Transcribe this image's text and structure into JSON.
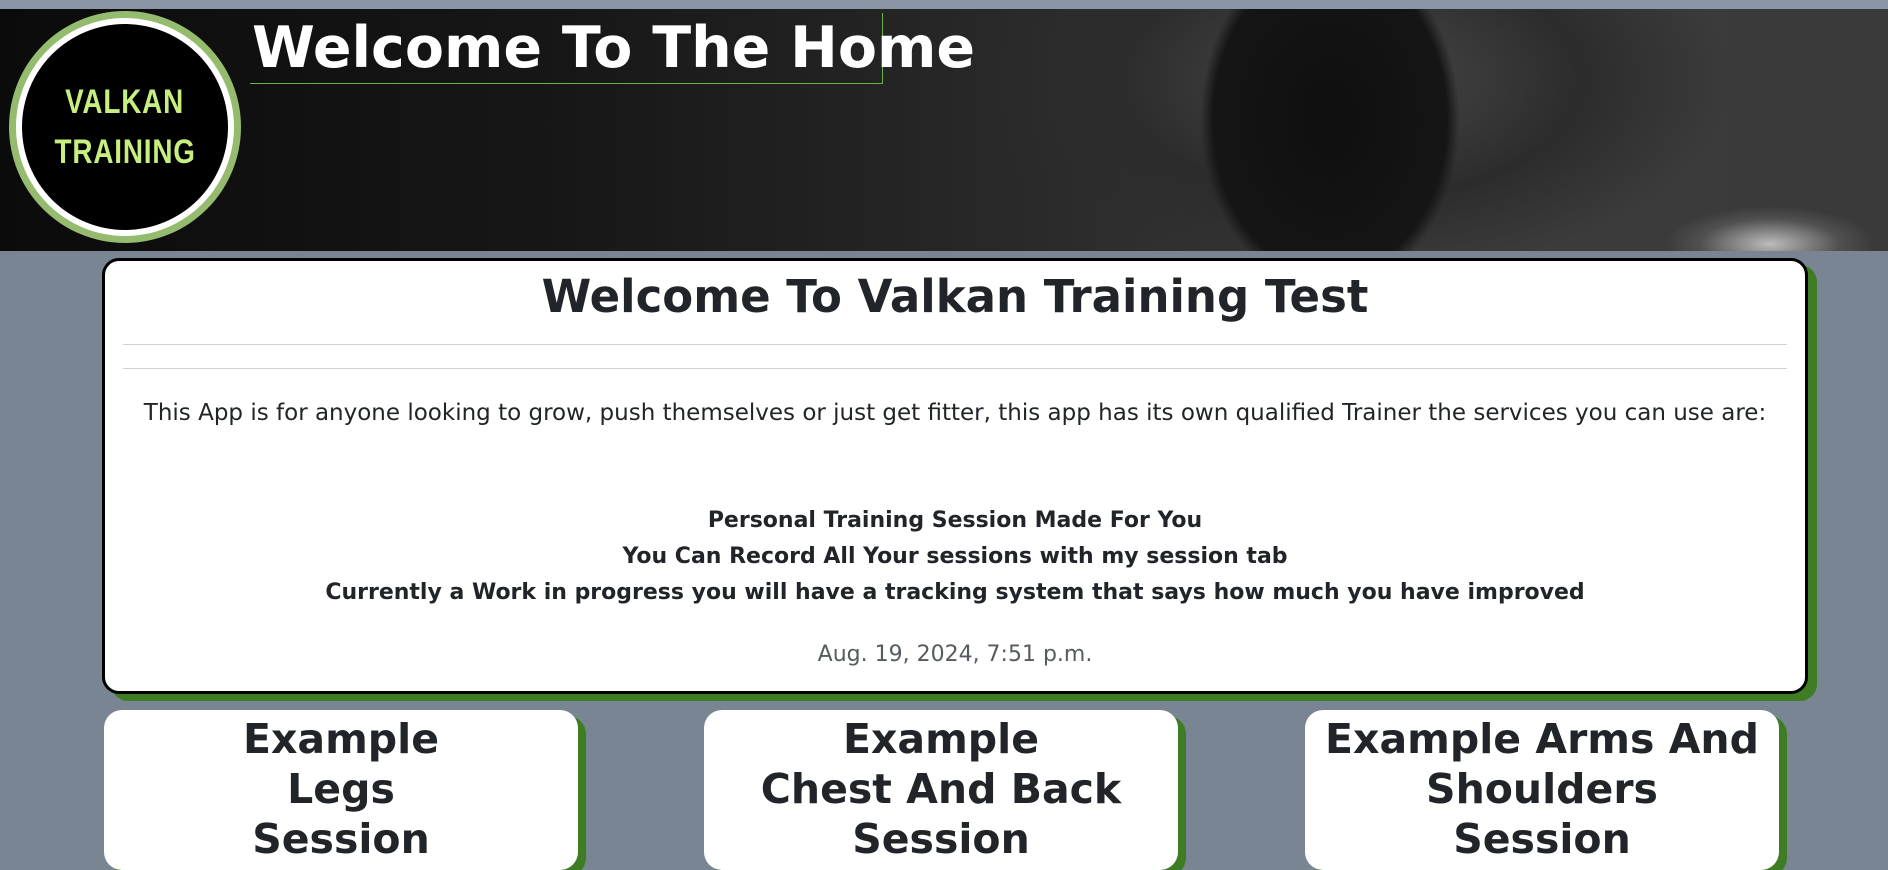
{
  "header": {
    "logo": {
      "line1": "VALKAN",
      "line2": "TRAINING"
    },
    "title": "Welcome To The Home"
  },
  "welcome": {
    "title": "Welcome To Valkan Training Test",
    "intro": "This App is for anyone looking to grow, push themselves or just get fitter, this app has its own qualified Trainer the services you can use are:",
    "features": [
      "Personal Training Session Made For You",
      "You Can Record All Your sessions with my session tab",
      "Currently a Work in progress you will have a tracking system that says how much you have improved"
    ],
    "date": "Aug. 19, 2024, 7:51 p.m."
  },
  "sessions": [
    {
      "lines": [
        "Example",
        "Legs",
        "Session"
      ]
    },
    {
      "lines": [
        "Example",
        "Chest And Back",
        "Session"
      ]
    },
    {
      "lines": [
        "Example Arms And",
        "Shoulders",
        "Session"
      ]
    }
  ],
  "colors": {
    "page_background": "#798592",
    "accent_green": "#3f7d24",
    "logo_text": "#c7ef7f",
    "logo_ring": "#95bb6e"
  }
}
